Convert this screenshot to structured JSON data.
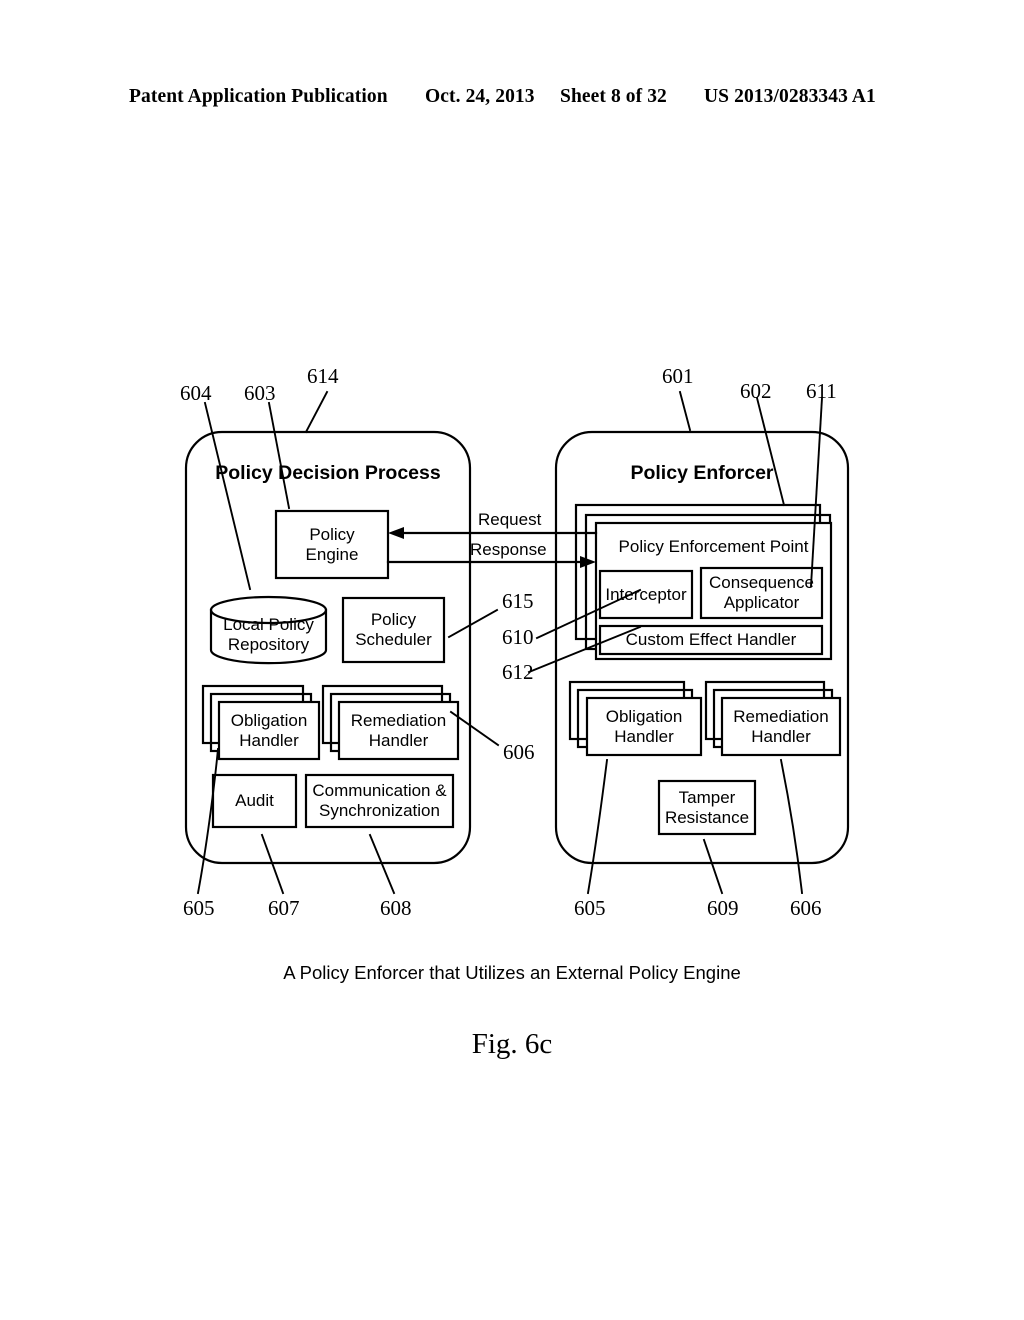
{
  "header": {
    "publication": "Patent Application Publication",
    "date": "Oct. 24, 2013",
    "sheet": "Sheet 8 of 32",
    "patent_number": "US 2013/0283343 A1"
  },
  "figure": {
    "caption": "A Policy Enforcer that Utilizes an External Policy Engine",
    "number": "Fig. 6c",
    "left_container": {
      "title": "Policy Decision Process",
      "ref": "614",
      "blocks": {
        "policy_engine": {
          "label": "Policy\nEngine",
          "ref": "603"
        },
        "local_policy_repository": {
          "label": "Local Policy\nRepository",
          "ref": "604"
        },
        "policy_scheduler": {
          "label": "Policy\nScheduler",
          "ref": "615"
        },
        "obligation_handler": {
          "label": "Obligation\nHandler",
          "ref": "605",
          "stacked": 3
        },
        "remediation_handler": {
          "label": "Remediation\nHandler",
          "ref": "606",
          "stacked": 3
        },
        "audit": {
          "label": "Audit",
          "ref": "607"
        },
        "communication_sync": {
          "label": "Communication &\nSynchronization",
          "ref": "608"
        }
      }
    },
    "right_container": {
      "title": "Policy Enforcer",
      "ref": "601",
      "blocks": {
        "policy_enforcement_point": {
          "label": "Policy Enforcement Point",
          "ref": "602",
          "stacked": 3
        },
        "interceptor": {
          "label": "Interceptor",
          "ref": "610"
        },
        "consequence_applicator": {
          "label": "Consequence\nApplicator",
          "ref": "611"
        },
        "custom_effect_handler": {
          "label": "Custom Effect Handler",
          "ref": "612"
        },
        "obligation_handler": {
          "label": "Obligation\nHandler",
          "ref": "605",
          "stacked": 3
        },
        "remediation_handler": {
          "label": "Remediation\nHandler",
          "ref": "606",
          "stacked": 3
        },
        "tamper_resistance": {
          "label": "Tamper\nResistance",
          "ref": "609"
        }
      }
    },
    "flows": [
      {
        "label": "Request",
        "direction": "right-to-left"
      },
      {
        "label": "Response",
        "direction": "left-to-right"
      }
    ],
    "ref_numbers_top": [
      "604",
      "603",
      "614",
      "601",
      "602",
      "611"
    ],
    "ref_numbers_middle": [
      "615",
      "610",
      "612",
      "606"
    ],
    "ref_numbers_bottom": [
      "605",
      "607",
      "608",
      "605",
      "609",
      "606"
    ]
  },
  "colors": {
    "ink": "#000000",
    "paper": "#ffffff"
  }
}
